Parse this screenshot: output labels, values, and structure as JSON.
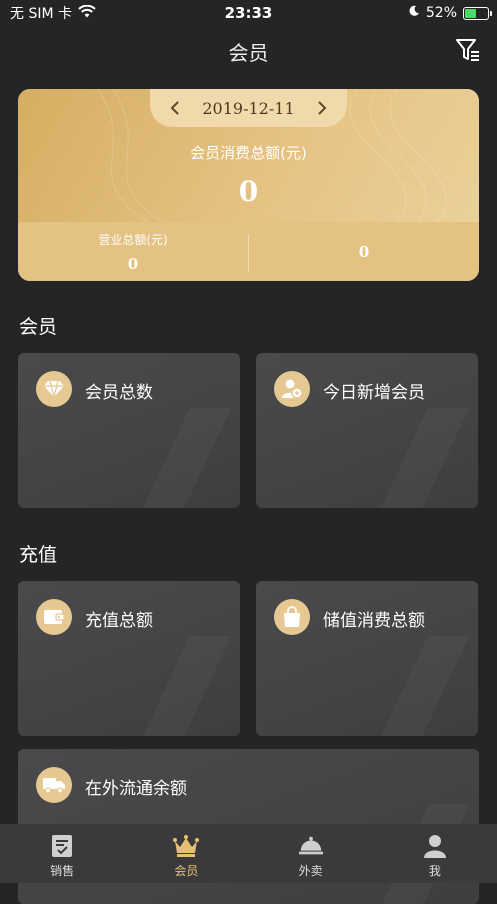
{
  "status_bar": {
    "carrier": "无 SIM 卡",
    "time": "23:33",
    "battery": "52%"
  },
  "header": {
    "title": "会员"
  },
  "summary": {
    "date": "2019-12-11",
    "total_label": "会员消费总额(元)",
    "total_value": "0",
    "revenue_label": "营业总额(元)",
    "revenue_value": "0",
    "right_value": "0"
  },
  "sections": {
    "member": {
      "title": "会员",
      "card1": "会员总数",
      "card2": "今日新增会员"
    },
    "recharge": {
      "title": "充值",
      "card1": "充值总额",
      "card2": "储值消费总额",
      "card3": "在外流通余额"
    }
  },
  "tabs": [
    {
      "label": "销售",
      "icon": "clipboard-check-icon"
    },
    {
      "label": "会员",
      "icon": "crown-icon"
    },
    {
      "label": "外卖",
      "icon": "cloche-icon"
    },
    {
      "label": "我",
      "icon": "person-icon"
    }
  ],
  "colors": {
    "accent": "#e6c070",
    "gold": "#d9b46a",
    "background": "#252528",
    "card": "#474749"
  }
}
